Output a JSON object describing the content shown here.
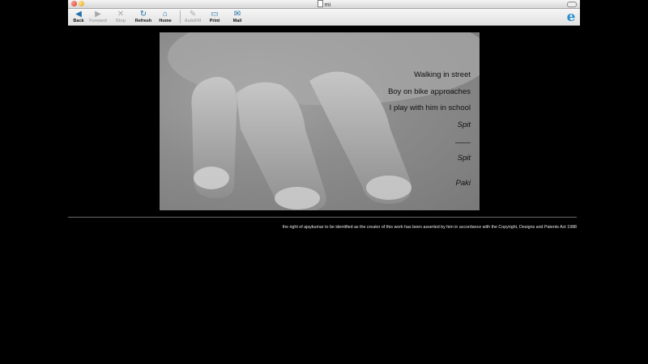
{
  "window": {
    "title": "mi"
  },
  "toolbar": {
    "buttons": [
      {
        "label": "Back",
        "icon": "back-arrow-icon",
        "enabled": true
      },
      {
        "label": "Forward",
        "icon": "forward-arrow-icon",
        "enabled": false
      },
      {
        "label": "Stop",
        "icon": "stop-icon",
        "enabled": false
      },
      {
        "label": "Refresh",
        "icon": "refresh-icon",
        "enabled": true
      },
      {
        "label": "Home",
        "icon": "home-icon",
        "enabled": true
      },
      {
        "label": "AutoFill",
        "icon": "autofill-icon",
        "enabled": false
      },
      {
        "label": "Print",
        "icon": "print-icon",
        "enabled": true
      },
      {
        "label": "Mail",
        "icon": "mail-icon",
        "enabled": true
      }
    ],
    "brand_icon": "internet-explorer-icon"
  },
  "artwork": {
    "image": "hand-photo",
    "lines": [
      "Walking in street",
      "Boy on bike approaches",
      "I play with him in school",
      "Spit",
      "——",
      "Spit",
      "Paki"
    ]
  },
  "footer": {
    "copyright": "the right of ajaykumar to be identified as the creator of this work has been asserted by him in accordance with the Copyright, Designs and Patents Act 1988"
  },
  "colors": {
    "background": "#000000",
    "toolbar_icon": "#1e6fa8",
    "disabled": "#a8a8a8"
  }
}
